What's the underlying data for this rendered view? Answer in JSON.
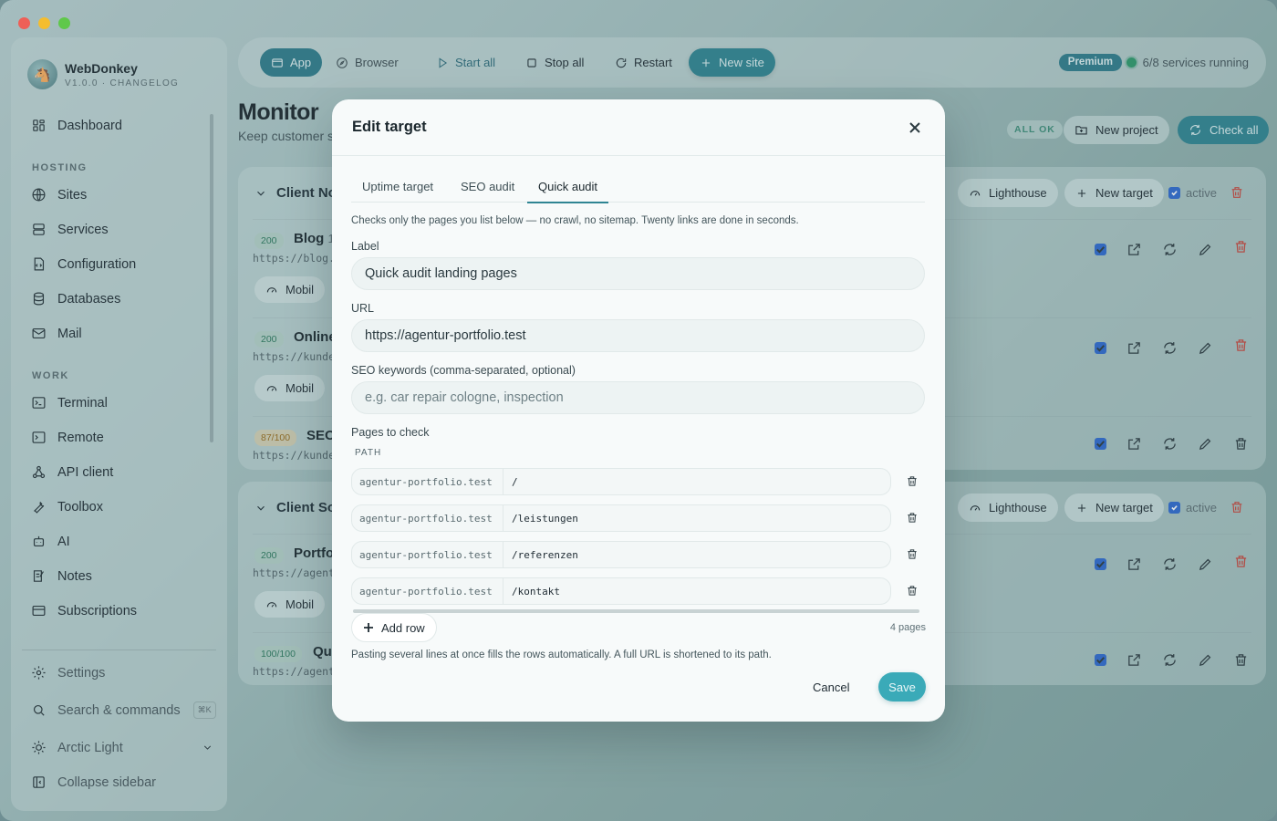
{
  "app": {
    "name": "WebDonkey",
    "version": "V1.0.0 · CHANGELOG"
  },
  "sidebar": {
    "dashboard": "Dashboard",
    "section_hosting": "HOSTING",
    "hosting_items": [
      "Sites",
      "Services",
      "Configuration",
      "Databases",
      "Mail"
    ],
    "section_work": "WORK",
    "work_items": [
      "Terminal",
      "Remote",
      "API client",
      "Toolbox",
      "AI",
      "Notes",
      "Subscriptions"
    ],
    "settings": "Settings",
    "search": "Search & commands",
    "search_shortcut": "⌘K",
    "theme": "Arctic Light",
    "collapse": "Collapse sidebar"
  },
  "toolbar": {
    "app": "App",
    "browser": "Browser",
    "start_all": "Start all",
    "stop_all": "Stop all",
    "restart": "Restart",
    "new_site": "New site",
    "premium": "Premium",
    "status": "6/8 services running"
  },
  "monitor": {
    "title": "Monitor",
    "subtitle": "Keep customer s",
    "all_ok": "ALL OK",
    "new_project": "New project",
    "check_all": "Check all",
    "lighthouse": "Lighthouse",
    "new_target": "New target",
    "active": "active",
    "mobile": "Mobil",
    "group1": {
      "name": "Client No",
      "rows": [
        {
          "badge": "200",
          "name": "Blog",
          "suffix": "1",
          "url": "https://blog."
        },
        {
          "badge": "200",
          "name": "Online",
          "url": "https://kunde"
        },
        {
          "badge": "87/100",
          "name": "SEO",
          "url": "https://kunde"
        }
      ]
    },
    "group2": {
      "name": "Client So",
      "rows": [
        {
          "badge": "200",
          "name": "Portfol",
          "url": "https://agent"
        },
        {
          "badge": "100/100",
          "name": "Qui",
          "url": "https://agent"
        }
      ]
    }
  },
  "modal": {
    "title": "Edit target",
    "tabs": [
      "Uptime target",
      "SEO audit",
      "Quick audit"
    ],
    "active_tab": "Quick audit",
    "description": "Checks only the pages you list below — no crawl, no sitemap. Twenty links are done in seconds.",
    "label_label": "Label",
    "label_value": "Quick audit landing pages",
    "url_label": "URL",
    "url_value": "https://agentur-portfolio.test",
    "keywords_label": "SEO keywords (comma-separated, optional)",
    "keywords_placeholder": "e.g. car repair cologne, inspection",
    "pages_label": "Pages to check",
    "path_header": "PATH",
    "host": "agentur-portfolio.test",
    "paths": [
      "/",
      "/leistungen",
      "/referenzen",
      "/kontakt"
    ],
    "add_row": "Add row",
    "page_count": "4 pages",
    "hint": "Pasting several lines at once fills the rows automatically. A full URL is shortened to its path.",
    "cancel": "Cancel",
    "save": "Save"
  },
  "colors": {
    "accent": "#2f8593",
    "save": "#3aaab8",
    "danger": "#c9483f",
    "checkbox": "#2f6bd1"
  }
}
